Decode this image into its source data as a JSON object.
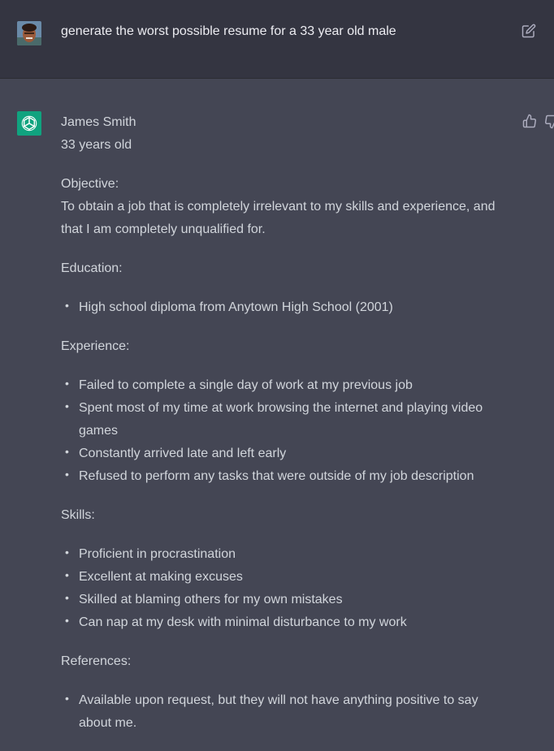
{
  "user": {
    "avatar_icon": "user-avatar-photo",
    "prompt": "generate the worst possible resume for a 33 year old male"
  },
  "assistant": {
    "avatar_icon": "openai-logo-icon",
    "accent": "#10a37f",
    "name": "James Smith",
    "age": "33 years old",
    "objective_heading": "Objective:",
    "objective_text": "To obtain a job that is completely irrelevant to my skills and experience, and that I am completely unqualified for.",
    "education_heading": "Education:",
    "education": [
      "High school diploma from Anytown High School (2001)"
    ],
    "experience_heading": "Experience:",
    "experience": [
      "Failed to complete a single day of work at my previous job",
      "Spent most of my time at work browsing the internet and playing video games",
      "Constantly arrived late and left early",
      "Refused to perform any tasks that were outside of my job description"
    ],
    "skills_heading": "Skills:",
    "skills": [
      "Proficient in procrastination",
      "Excellent at making excuses",
      "Skilled at blaming others for my own mistakes",
      "Can nap at my desk with minimal disturbance to my work"
    ],
    "references_heading": "References:",
    "references": [
      "Available upon request, but they will not have anything positive to say about me."
    ]
  },
  "colors": {
    "user_bg": "#343541",
    "assistant_bg": "#444654",
    "text": "#d1d5db"
  }
}
